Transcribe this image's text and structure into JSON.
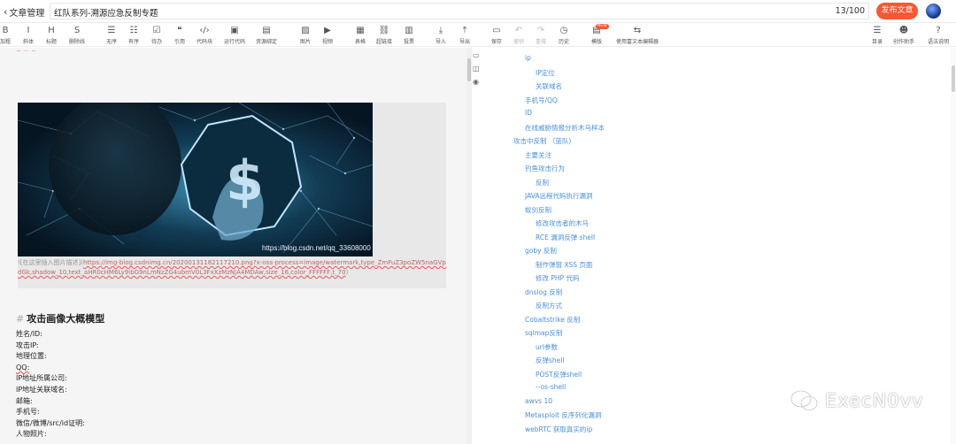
{
  "header": {
    "back_label": "文章管理",
    "title_value": "红队系列-溯源应急反制专题",
    "counter": "13/100",
    "publish_label": "发布文章"
  },
  "toolbar": {
    "left": [
      {
        "icon": "bold-icon",
        "glyph": "B",
        "label": "加粗"
      },
      {
        "icon": "italic-icon",
        "glyph": "I",
        "label": "斜体"
      },
      {
        "icon": "heading-icon",
        "glyph": "H",
        "label": "标题"
      },
      {
        "icon": "strikethrough-icon",
        "glyph": "S",
        "label": "删除线"
      },
      {
        "icon": "unordered-list-icon",
        "glyph": "☰",
        "label": "无序"
      },
      {
        "icon": "ordered-list-icon",
        "glyph": "☷",
        "label": "有序"
      },
      {
        "icon": "task-list-icon",
        "glyph": "☑",
        "label": "待办"
      },
      {
        "icon": "quote-icon",
        "glyph": "❝",
        "label": "引用"
      },
      {
        "icon": "code-block-icon",
        "glyph": "‹/›",
        "label": "代码块"
      },
      {
        "icon": "run-code-icon",
        "glyph": "▣",
        "label": "运行代码"
      },
      {
        "icon": "resource-icon",
        "glyph": "▤",
        "label": "资源绑定"
      },
      {
        "icon": "image-icon",
        "glyph": "▨",
        "label": "图片"
      },
      {
        "icon": "video-icon",
        "glyph": "▶",
        "label": "视频"
      },
      {
        "icon": "table-icon",
        "glyph": "▦",
        "label": "表格"
      },
      {
        "icon": "link-icon",
        "glyph": "⛓",
        "label": "超链接"
      },
      {
        "icon": "vote-icon",
        "glyph": "▥",
        "label": "投票"
      },
      {
        "icon": "import-icon",
        "glyph": "⤓",
        "label": "导入"
      },
      {
        "icon": "export-icon",
        "glyph": "⤒",
        "label": "导出"
      },
      {
        "icon": "save-icon",
        "glyph": "▭",
        "label": "保存"
      },
      {
        "icon": "undo-icon",
        "glyph": "↶",
        "label": "撤销"
      },
      {
        "icon": "redo-icon",
        "glyph": "↷",
        "label": "重做"
      },
      {
        "icon": "history-icon",
        "glyph": "◷",
        "label": "历史"
      },
      {
        "icon": "template-icon",
        "glyph": "▤",
        "label": "模版",
        "badge": "NEW"
      },
      {
        "icon": "switch-editor-icon",
        "glyph": "⇆",
        "label": "使用富文本编辑器"
      }
    ],
    "right": [
      {
        "icon": "toc-icon",
        "glyph": "☰",
        "label": "目录"
      },
      {
        "icon": "assistant-icon",
        "glyph": "☻",
        "label": "创作助手"
      },
      {
        "icon": "help-icon",
        "glyph": "?",
        "label": "语法说明"
      }
    ]
  },
  "editor": {
    "image_watermark": "https://blog.csdn.net/qq_33608000",
    "image_caption_prefix": "![在这里插入图片描述](",
    "image_caption_url": "https://img-blog.csdnimg.cn/20200131182117210.png?x-oss-process=image/watermark,type_ZmFuZ3poZW5naGVpdGk,shadow_10,text_aHR0cHM6Ly9ibG9nLmNzZG4ubmV0L3FxXzMzNjA4MDAw,size_16,color_FFFFFF,t_70",
    "image_caption_suffix": ")",
    "heading": "攻击画像大概模型",
    "heading_mark": "#",
    "lines": [
      "姓名/ID:",
      "攻击IP:",
      "地理位置:",
      "QQ:",
      "IP地址所属公司:",
      "IP地址关联域名:",
      "邮箱:",
      "手机号:",
      "微信/微博/src/id证明:",
      "人物照片:"
    ]
  },
  "toc": [
    {
      "text": "ip",
      "level": 2
    },
    {
      "text": "IP定位",
      "level": 3
    },
    {
      "text": "关联域名",
      "level": 3
    },
    {
      "text": "手机号/QQ",
      "level": 2
    },
    {
      "text": "ID",
      "level": 2
    },
    {
      "text": "在线威胁情报分析木马样本",
      "level": 2
    },
    {
      "text": "攻击中反制 （蓝队)",
      "level": 1
    },
    {
      "text": "主要关注",
      "level": 2
    },
    {
      "text": "钓鱼攻击行为",
      "level": 2
    },
    {
      "text": "反制",
      "level": 3
    },
    {
      "text": "JAVA远程代码执行漏洞",
      "level": 2
    },
    {
      "text": "蚁剑反制",
      "level": 2
    },
    {
      "text": "修改攻击者的木马",
      "level": 3
    },
    {
      "text": "RCE 漏洞反弹 shell",
      "level": 3
    },
    {
      "text": "goby 反制",
      "level": 2
    },
    {
      "text": "制作弹窗 XSS 页面",
      "level": 3
    },
    {
      "text": "修改 PHP 代码",
      "level": 3
    },
    {
      "text": "dnslog 反制",
      "level": 2
    },
    {
      "text": "反制方式",
      "level": 3
    },
    {
      "text": "Cobaltstrike 反制",
      "level": 2
    },
    {
      "text": "sqlmap反制",
      "level": 2
    },
    {
      "text": "url参数",
      "level": 3
    },
    {
      "text": "反弹shell",
      "level": 3
    },
    {
      "text": "POST反弹shell",
      "level": 3
    },
    {
      "text": "--os-shell",
      "level": 3
    },
    {
      "text": "awvs 10",
      "level": 2
    },
    {
      "text": "Metasploit 反序列化漏洞",
      "level": 2
    },
    {
      "text": "webRTC 获取真实的ip",
      "level": 2
    }
  ],
  "watermark": "ExecN0vv",
  "colors": {
    "accent": "#fc5531",
    "toc_link": "#4a8fe0"
  }
}
